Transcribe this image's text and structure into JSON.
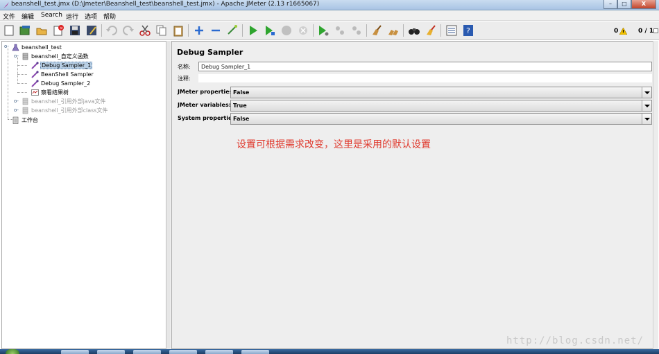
{
  "window": {
    "title": "beanshell_test.jmx (D:\\Jmeter\\Beanshell_test\\beanshell_test.jmx) - Apache JMeter (2.13 r1665067)",
    "minimize_glyph": "–",
    "maximize_glyph": "□",
    "close_glyph": "X"
  },
  "menu": [
    "文件",
    "编辑",
    "Search",
    "运行",
    "选项",
    "帮助"
  ],
  "toolbar": {
    "error_count": "0",
    "thread_count": "0 / 1"
  },
  "tree": {
    "root": "beanshell_test",
    "group1": "beanshell_自定义函数",
    "sampler1": "Debug Sampler_1",
    "sampler2": "BeanShell Sampler",
    "sampler3": "Debug Sampler_2",
    "listener": "察看结果树",
    "group2": "beanshell_引用外部java文件",
    "group3": "beanshell_引用外部class文件",
    "workbench": "工作台"
  },
  "panel": {
    "title": "Debug Sampler",
    "name_label": "名称:",
    "name_value": "Debug Sampler_1",
    "comment_label": "注释:",
    "props": [
      {
        "label": "JMeter properties:",
        "value": "False"
      },
      {
        "label": "JMeter variables:",
        "value": "True"
      },
      {
        "label": "System properties:",
        "value": "False"
      }
    ],
    "annotation": "设置可根据需求改变，这里是采用的默认设置"
  },
  "watermark": "http://blog.csdn.net/",
  "colors": {
    "annotation": "#e03a2e",
    "selection": "#b8cfe5",
    "run_green": "#2fa52f"
  }
}
